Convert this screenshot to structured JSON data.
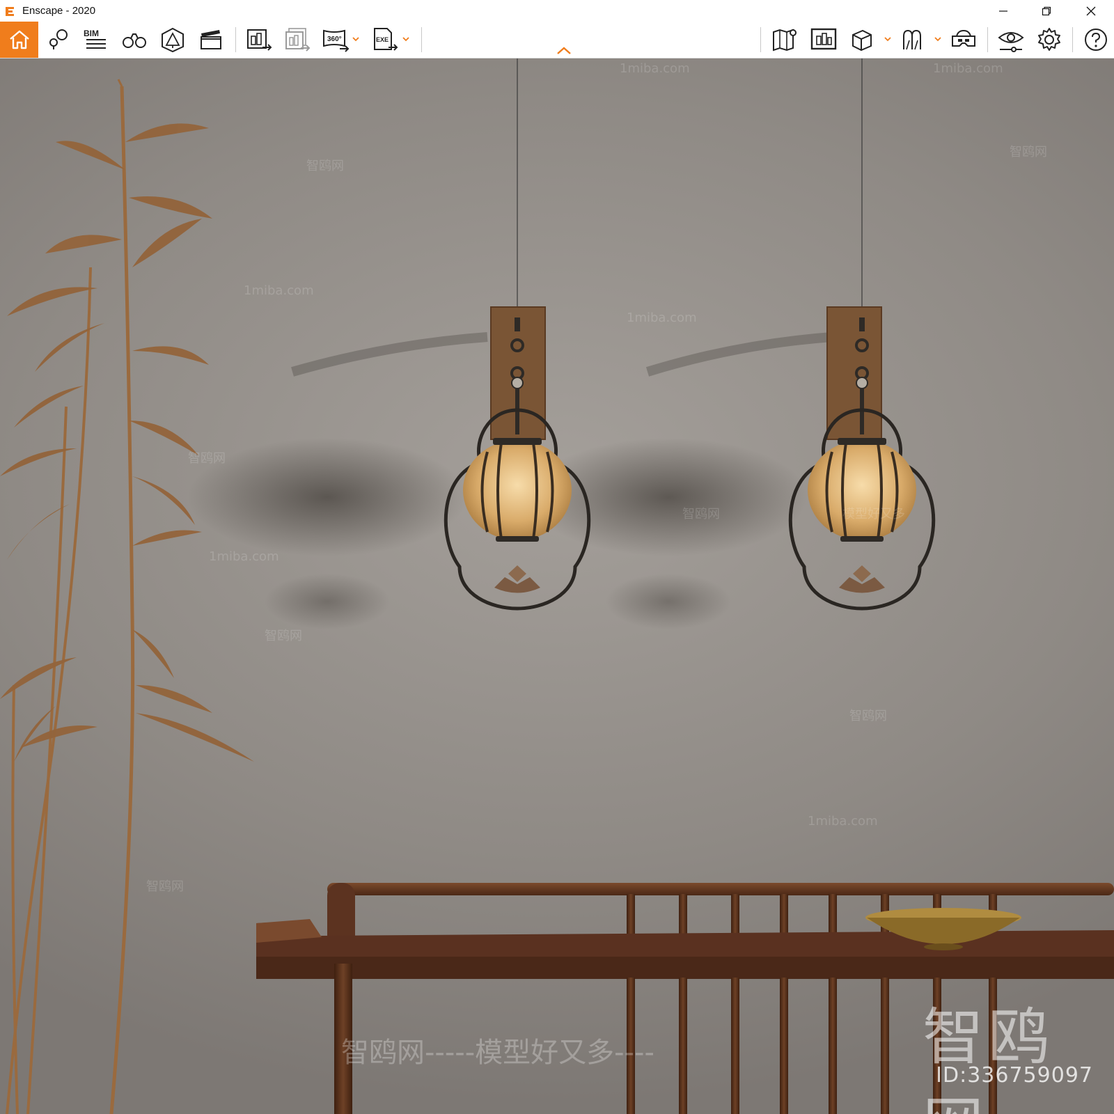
{
  "window": {
    "title": "Enscape - 2020",
    "controls": [
      "minimize",
      "restore",
      "close"
    ]
  },
  "toolbar": {
    "accent_color": "#f07d1c",
    "groups": [
      [
        "home-icon",
        "pin-annotation-icon",
        "bim-icon",
        "binoculars-icon",
        "sun-triangle-icon",
        "clapperboard-icon"
      ],
      [
        "render-image-icon",
        "batch-render-icon",
        "panorama-360-icon",
        "export-exe-icon"
      ],
      [
        "map-icon",
        "screenshot-icon",
        "cube-icon",
        "asset-library-icon",
        "vr-headset-icon"
      ],
      [
        "eye-settings-icon",
        "gear-icon"
      ],
      [
        "help-icon"
      ]
    ],
    "bim_label": "BIM",
    "pano_label": "360°",
    "exe_label": "EXE"
  },
  "viewport": {
    "watermarks": {
      "big": "智鸥网",
      "line": "智鸥网-----模型好又多----",
      "id": "ID:336759097",
      "small_site": "1miba.com",
      "small_brand": "智鸥网",
      "slogan": "模型好又多"
    }
  }
}
